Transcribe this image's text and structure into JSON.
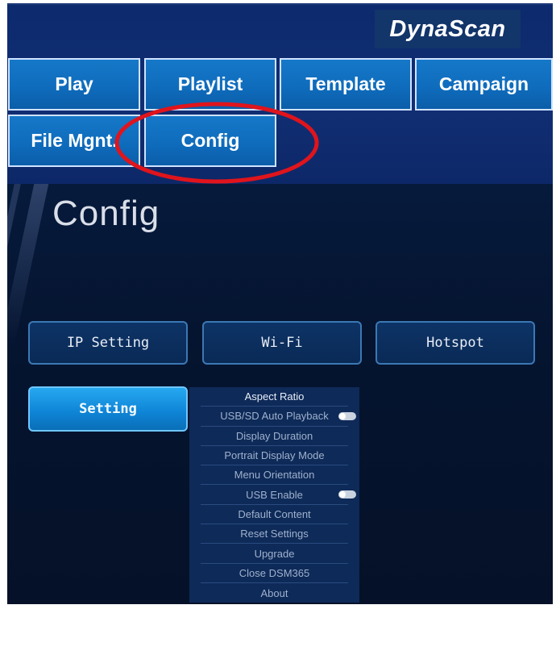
{
  "brand": {
    "name": "DynaScan"
  },
  "nav": {
    "play": "Play",
    "playlist": "Playlist",
    "template": "Template",
    "campaign": "Campaign",
    "file_mgmt": "File Mgnt.",
    "config": "Config"
  },
  "colors": {
    "header_bg": "#0d2a6e",
    "nav_button": "#0f6cbd",
    "content_bg": "#061530",
    "highlight_circle": "#e0141c",
    "setting_active": "#1896e6"
  },
  "page": {
    "title": "Config"
  },
  "config_buttons": {
    "ip_setting": "IP Setting",
    "wifi": "Wi-Fi",
    "hotspot": "Hotspot",
    "setting": "Setting"
  },
  "setting_menu": {
    "items": [
      "Aspect Ratio",
      "USB/SD Auto Playback",
      "Display Duration",
      "Portrait Display Mode",
      "Menu Orientation",
      "USB Enable",
      "Default Content",
      "Reset Settings",
      "Upgrade",
      "Close DSM365",
      "About"
    ],
    "toggles": {
      "usb_sd_auto_playback": "off",
      "usb_enable": "off"
    }
  }
}
